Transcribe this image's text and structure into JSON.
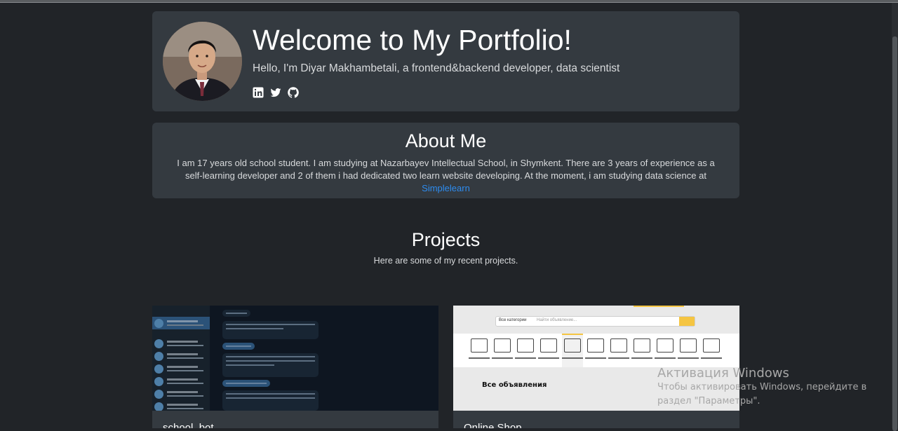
{
  "hero": {
    "title": "Welcome to My Portfolio!",
    "subtitle": "Hello, I'm Diyar Makhambetali, a frontend&backend developer, data scientist",
    "socials": [
      "linkedin-icon",
      "twitter-icon",
      "github-icon"
    ]
  },
  "about": {
    "title": "About Me",
    "text": "I am 17 years old school student. I am studying at Nazarbayev Intellectual School, in Shymkent. There are 3 years of experience as a self-learning developer and 2 of them i had dedicated two learn website developing. At the moment, i am studying data science at ",
    "link_text": "Simplelearn"
  },
  "projects": {
    "title": "Projects",
    "subtitle": "Here are some of my recent projects.",
    "items": [
      {
        "name": "school_bot"
      },
      {
        "name": "Online Shop",
        "preview": {
          "category_select": "Все категории",
          "search_placeholder": "Найти объявление...",
          "all_listings": "Все объявления"
        }
      }
    ]
  },
  "watermark": {
    "title": "Активация Windows",
    "line1": "Чтобы активировать Windows, перейдите в",
    "line2": "раздел \"Параметры\"."
  },
  "colors": {
    "background": "#212428",
    "card": "#343a40",
    "link": "#2d8cf0",
    "accent": "#f5c542"
  }
}
